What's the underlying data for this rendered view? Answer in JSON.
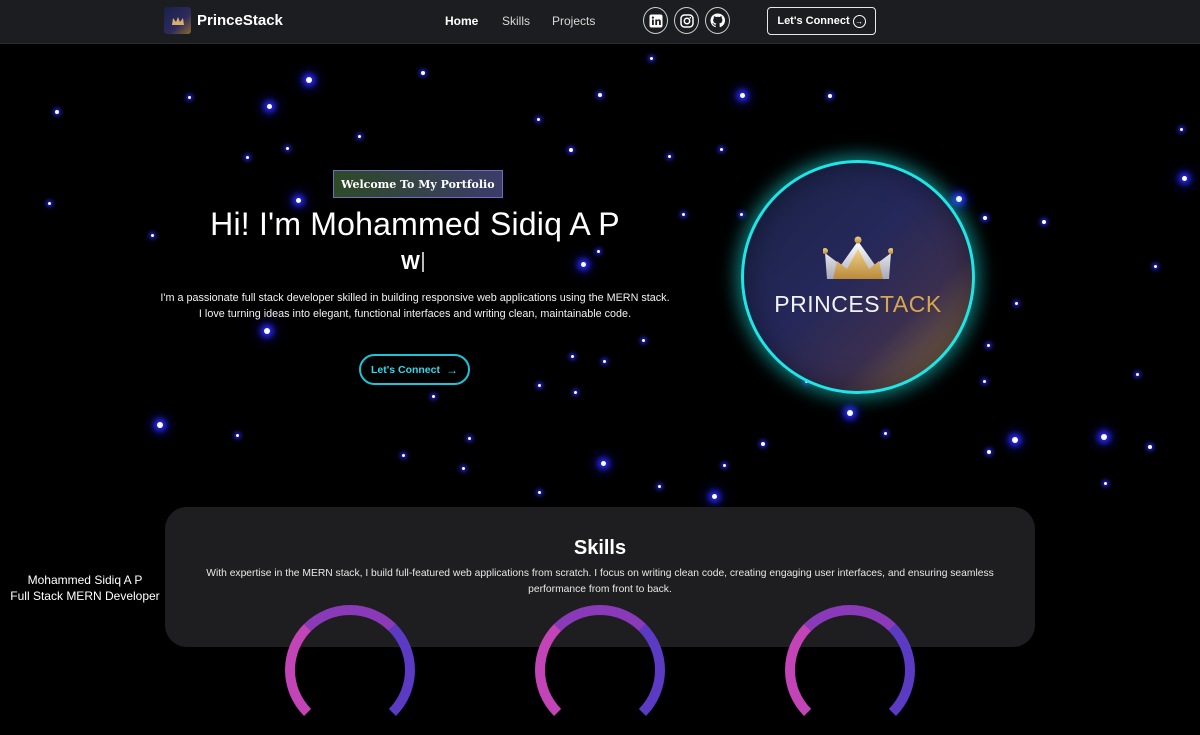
{
  "navbar": {
    "brand": "PrinceStack",
    "links": [
      {
        "label": "Home",
        "active": true
      },
      {
        "label": "Skills",
        "active": false
      },
      {
        "label": "Projects",
        "active": false
      }
    ],
    "social_icons": [
      "linkedin-icon",
      "instagram-icon",
      "github-icon"
    ],
    "cta_label": "Let's Connect"
  },
  "hero": {
    "tagline": "Welcome To My Portfolio",
    "title": "Hi! I'm Mohammed Sidiq A P",
    "typing_text": "W",
    "description": "I'm a passionate full stack developer skilled in building responsive web applications using the MERN stack. I love turning ideas into elegant, functional interfaces and writing clean, maintainable code.",
    "cta_label": "Let's Connect"
  },
  "logo": {
    "text_part1": "PRINCES",
    "text_part2": "TACK",
    "accent_cyan": "#1ee6e6",
    "accent_gold": "#d7a650"
  },
  "skills": {
    "title": "Skills",
    "description": "With expertise in the MERN stack, I build full-featured web applications from scratch. I focus on writing clean code, creating engaging user interfaces, and ensuring seamless performance from front to back."
  },
  "credit": {
    "name": "Mohammed Sidiq A P",
    "role": "Full Stack MERN Developer"
  }
}
